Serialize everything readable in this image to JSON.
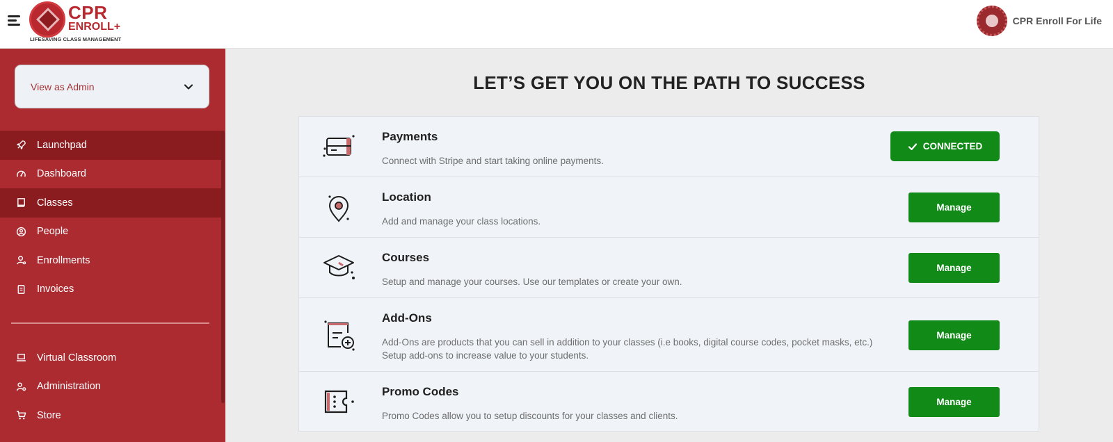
{
  "header": {
    "logo_title": "CPR",
    "logo_sub": "ENROLL",
    "logo_plus": "+",
    "logo_tagline": "LIFESAVING CLASS MANAGEMENT",
    "org_name": "CPR Enroll For Life"
  },
  "sidebar": {
    "view_select": {
      "value": "View as Admin"
    },
    "items": [
      {
        "label": "Launchpad",
        "icon": "rocket-icon",
        "active": true
      },
      {
        "label": "Dashboard",
        "icon": "gauge-icon",
        "active": false
      },
      {
        "label": "Classes",
        "icon": "book-icon",
        "active": true
      },
      {
        "label": "People",
        "icon": "user-circle-icon",
        "active": false
      },
      {
        "label": "Enrollments",
        "icon": "user-icon",
        "active": false
      },
      {
        "label": "Invoices",
        "icon": "receipt-icon",
        "active": false
      }
    ],
    "items2": [
      {
        "label": "Virtual Classroom",
        "icon": "laptop-icon"
      },
      {
        "label": "Administration",
        "icon": "user-gear-icon"
      },
      {
        "label": "Store",
        "icon": "cart-icon"
      }
    ]
  },
  "main": {
    "heading": "LET’S GET YOU ON THE PATH TO SUCCESS",
    "cards": [
      {
        "title": "Payments",
        "description": "Connect with Stripe and start taking online payments.",
        "button": "CONNECTED",
        "icon": "credit-card-icon"
      },
      {
        "title": "Location",
        "description": "Add and manage your class locations.",
        "button": "Manage",
        "icon": "location-pin-icon"
      },
      {
        "title": "Courses",
        "description": "Setup and manage your courses. Use our templates or create your own.",
        "button": "Manage",
        "icon": "graduation-cap-icon"
      },
      {
        "title": "Add-Ons",
        "description": "Add-Ons are products that you can sell in addition to your classes (i.e books, digital course codes, pocket masks, etc.) Setup add-ons to increase value to your students.",
        "button": "Manage",
        "icon": "add-on-list-icon"
      },
      {
        "title": "Promo Codes",
        "description": "Promo Codes allow you to setup discounts for your classes and clients.",
        "button": "Manage",
        "icon": "ticket-icon"
      }
    ]
  },
  "colors": {
    "brand_red": "#ab2b31",
    "sidebar_active": "#8a1b1f",
    "button_green": "#118a18"
  }
}
